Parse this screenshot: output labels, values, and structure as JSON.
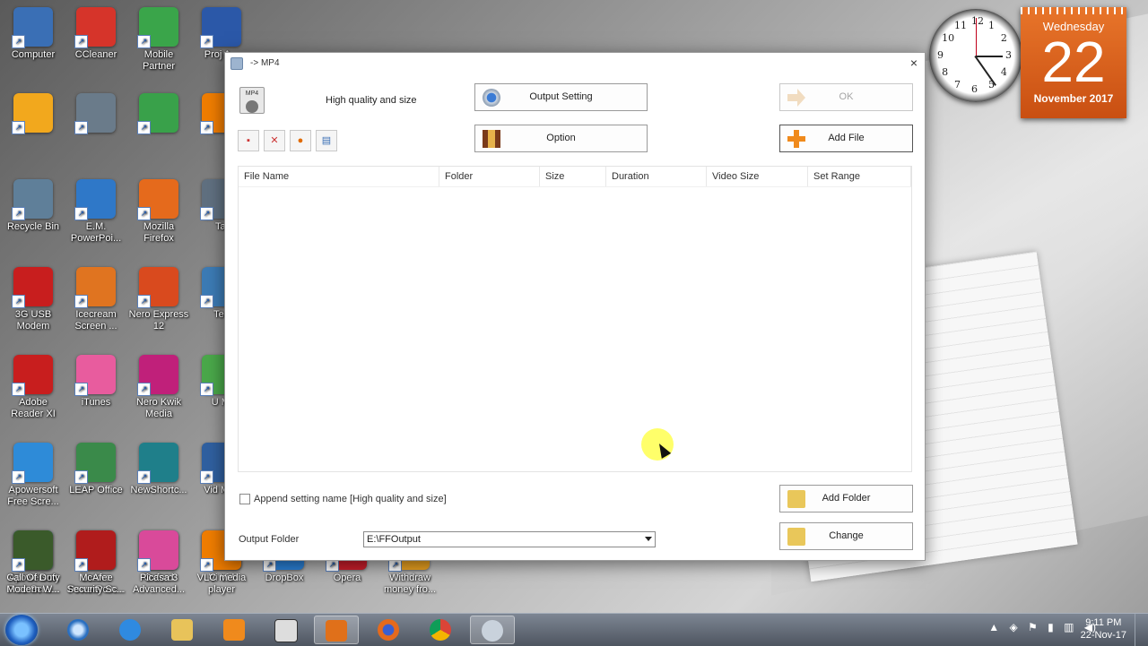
{
  "desktop": {
    "icons": [
      {
        "label": "Computer",
        "color": "#3a6fb5"
      },
      {
        "label": "CCleaner",
        "color": "#d6342a"
      },
      {
        "label": "Mobile Partner",
        "color": "#3aa54a"
      },
      {
        "label": "Proj A...",
        "color": "#2b58a8"
      },
      {
        "label": "",
        "color": "#f2a81d"
      },
      {
        "label": "",
        "color": "#6a7b8a"
      },
      {
        "label": "",
        "color": "#39a14a"
      },
      {
        "label": "",
        "color": "#f07d00"
      },
      {
        "label": "Recycle Bin",
        "color": "#5f7f99"
      },
      {
        "label": "E.M. PowerPoi...",
        "color": "#2f78c8"
      },
      {
        "label": "Mozilla Firefox",
        "color": "#e56a1c"
      },
      {
        "label": "Tal",
        "color": "#607080"
      },
      {
        "label": "3G USB Modem",
        "color": "#c81e1e"
      },
      {
        "label": "Icecream Screen ...",
        "color": "#e07420"
      },
      {
        "label": "Nero Express 12",
        "color": "#d94a1e"
      },
      {
        "label": "Tea",
        "color": "#3c7bb5"
      },
      {
        "label": "Adobe Reader XI",
        "color": "#c81e1e"
      },
      {
        "label": "iTunes",
        "color": "#e85c9e"
      },
      {
        "label": "Nero Kwik Media",
        "color": "#c0207a"
      },
      {
        "label": "U Mi",
        "color": "#4aa84a"
      },
      {
        "label": "Apowersoft Free Scre...",
        "color": "#2e8bd8"
      },
      {
        "label": "LEAP Office",
        "color": "#3a8a4a"
      },
      {
        "label": "NewShortc...",
        "color": "#1f7f8a"
      },
      {
        "label": "Vid Mov",
        "color": "#3060a0"
      },
      {
        "label": "Apowersoft Free Scre...",
        "color": "#29a8d8"
      },
      {
        "label": "Leawo PowerPoin...",
        "color": "#d8402a"
      },
      {
        "label": "Oxford Advanced...",
        "color": "#3a7bd5"
      },
      {
        "label": "Vi Vid",
        "color": "#404040"
      },
      {
        "label": "Call Of Duty Modern W...",
        "color": "#3a5a2a"
      },
      {
        "label": "McAfee Security Sc...",
        "color": "#b01c1c"
      },
      {
        "label": "Picasa 3",
        "color": "#d94a9a"
      },
      {
        "label": "VLC media player",
        "color": "#f07d00"
      },
      {
        "label": "DropBox",
        "color": "#2a7fd4"
      },
      {
        "label": "Opera",
        "color": "#c81e2a"
      },
      {
        "label": "Withdraw money fro...",
        "color": "#e8a020"
      }
    ],
    "clock": {
      "numbers": [
        "12",
        "1",
        "2",
        "3",
        "4",
        "5",
        "6",
        "7",
        "8",
        "9",
        "10",
        "11"
      ]
    },
    "calendar": {
      "weekday": "Wednesday",
      "day": "22",
      "month_year": "November 2017"
    }
  },
  "window": {
    "title": "-> MP4",
    "close_glyph": "×",
    "preset_icon_text": "MP4",
    "preset_label": "High quality and size",
    "buttons": {
      "output_setting": "Output Setting",
      "option": "Option",
      "ok": "OK",
      "add_file": "Add File",
      "add_folder": "Add Folder",
      "change": "Change"
    },
    "list_columns": [
      "File Name",
      "Folder",
      "Size",
      "Duration",
      "Video Size",
      "Set Range"
    ],
    "append_label": "Append setting name [High quality and size]",
    "output_folder_label": "Output Folder",
    "output_folder_value": "E:\\FFOutput"
  },
  "taskbar": {
    "time": "9:11 PM",
    "date": "22-Nov-17",
    "tray_arrow": "▲"
  }
}
